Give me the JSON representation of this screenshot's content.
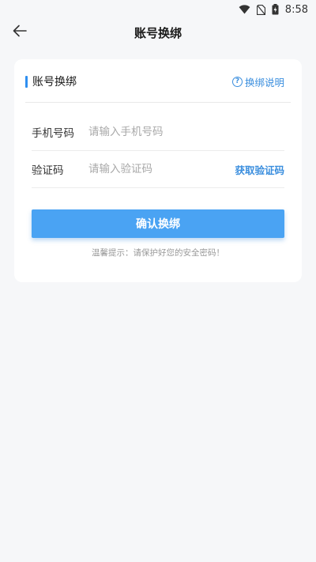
{
  "status_bar": {
    "time": "8:58",
    "icons": [
      "wifi-icon",
      "no-sim-icon",
      "battery-icon"
    ]
  },
  "nav": {
    "title": "账号换绑",
    "back_icon": "arrow-left-icon"
  },
  "card": {
    "section_title": "账号换绑",
    "help_icon": "question-circle-icon",
    "help_link": "换绑说明",
    "phone": {
      "label": "手机号码",
      "value": "",
      "placeholder": "请输入手机号码"
    },
    "code": {
      "label": "验证码",
      "value": "",
      "placeholder": "请输入验证码",
      "get_code": "获取验证码"
    },
    "confirm_button": "确认换绑",
    "tip": "温馨提示：请保护好您的安全密码！"
  },
  "colors": {
    "accent": "#2f8ff0",
    "link": "#3a8ede",
    "button": "#4aa3f3",
    "background": "#f6f7f9"
  }
}
